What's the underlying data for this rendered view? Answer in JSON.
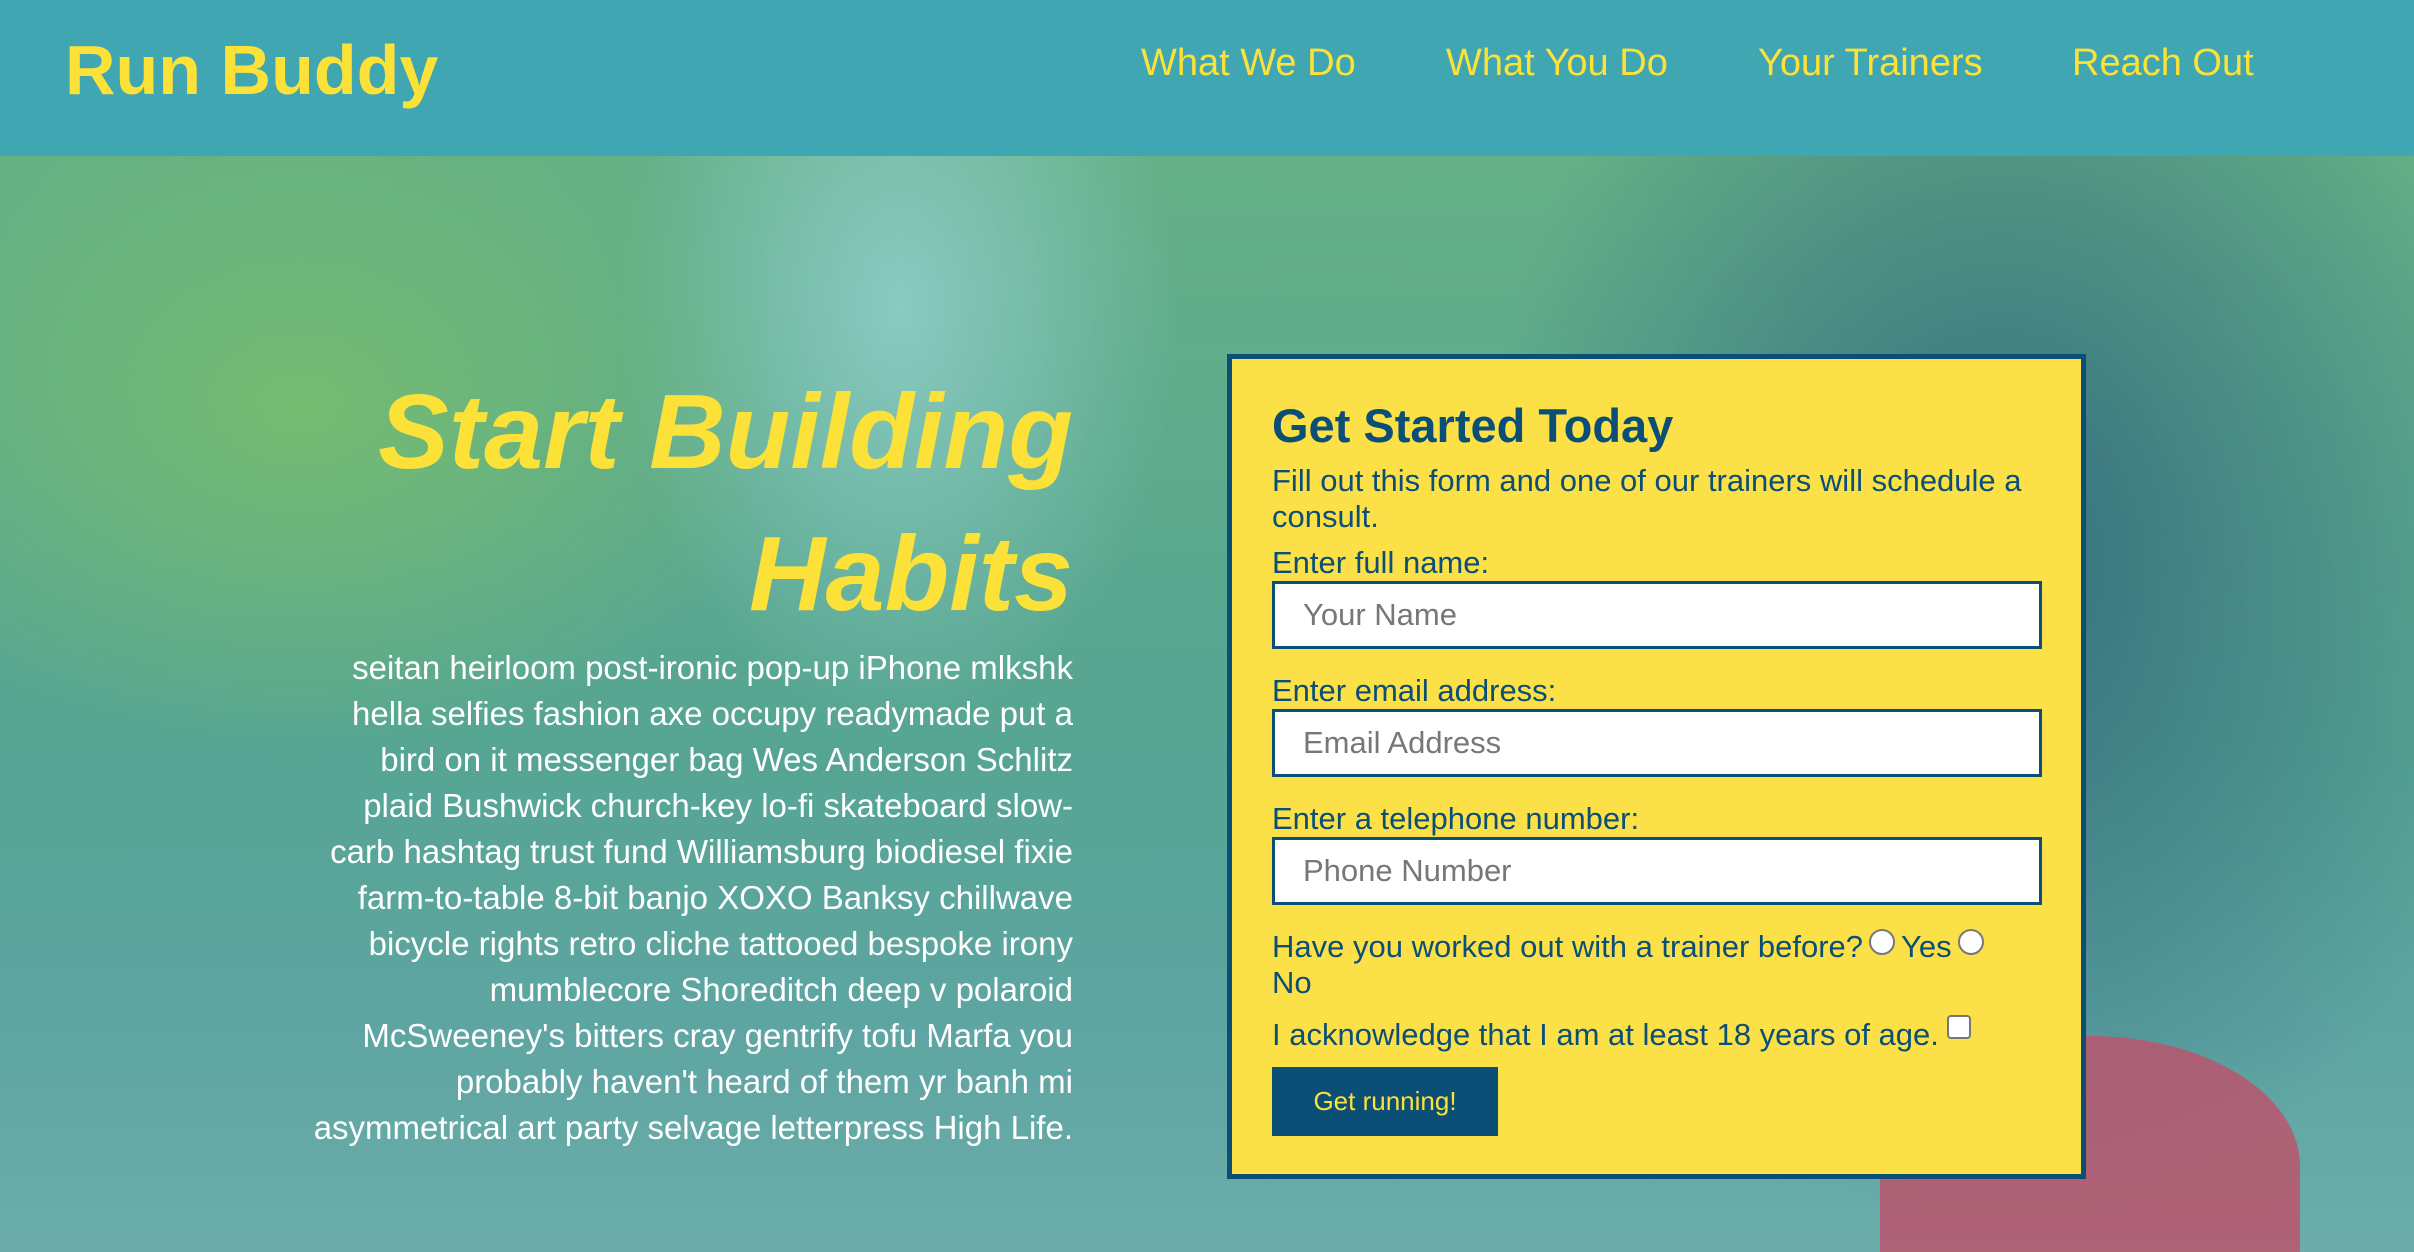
{
  "header": {
    "logo": "Run Buddy",
    "nav": [
      "What We Do",
      "What You Do",
      "Your Trainers",
      "Reach Out"
    ]
  },
  "hero": {
    "title": "Start Building Habits",
    "body": "seitan heirloom post-ironic pop-up iPhone mlkshk hella selfies fashion axe occupy readymade put a bird on it messenger bag Wes Anderson Schlitz plaid Bushwick church-key lo-fi skateboard slow-carb hashtag trust fund Williamsburg biodiesel fixie farm-to-table 8-bit banjo XOXO Banksy chillwave bicycle rights retro cliche tattooed bespoke irony mumblecore Shoreditch deep v polaroid McSweeney's bitters cray gentrify tofu Marfa you probably haven't heard of them yr banh mi asymmetrical art party selvage letterpress High Life."
  },
  "form": {
    "title": "Get Started Today",
    "intro": "Fill out this form and one of our trainers will schedule a consult.",
    "name_label": "Enter full name:",
    "name_placeholder": "Your Name",
    "email_label": "Enter email address:",
    "email_placeholder": "Email Address",
    "phone_label": "Enter a telephone number:",
    "phone_placeholder": "Phone Number",
    "trainer_question": "Have you worked out with a trainer before?",
    "yes_label": "Yes",
    "no_label": "No",
    "age_ack": "I acknowledge that I am at least 18 years of age.",
    "submit_label": "Get running!"
  },
  "colors": {
    "header_bg": "#3fa6b2",
    "accent_yellow": "#fce138",
    "navy": "#0b4f76"
  }
}
